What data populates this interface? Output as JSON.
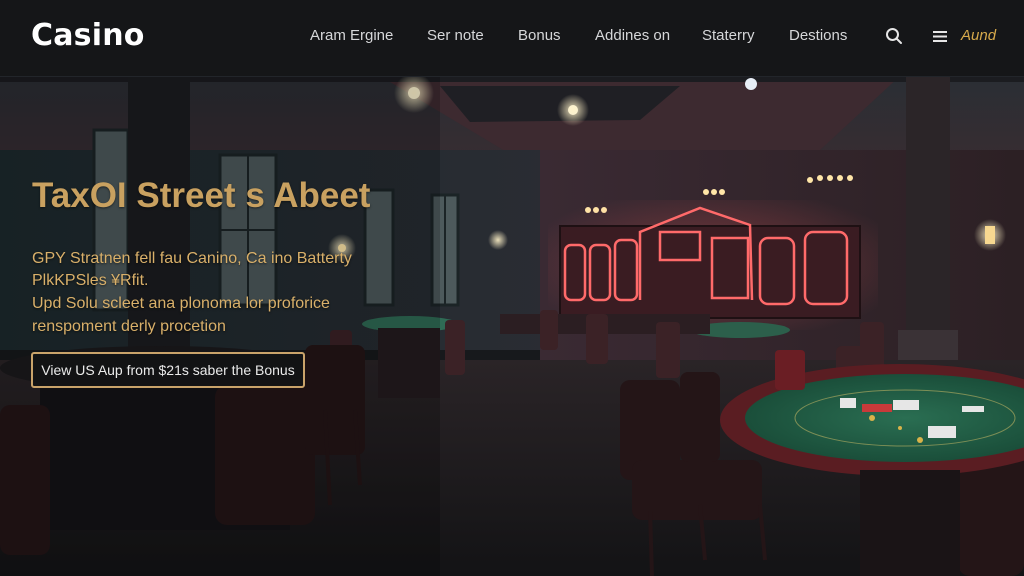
{
  "brand": {
    "logo": "Casino"
  },
  "nav": {
    "items": [
      "Aram Ergine",
      "Ser note",
      "Bonus",
      "Addines on",
      "Staterry",
      "Destions"
    ],
    "language": "Aund"
  },
  "hero": {
    "title": "TaxOI Street s Abeet",
    "lines": [
      "GPY Stratnen fell fau Canino, Ca ino Batterty",
      "PlkKPSles ¥Rfit.",
      "Upd Solu scleet ana plonoma lor proforice",
      "renspoment derly procetion"
    ],
    "cta_label": "View US Aup from $21s saber the Bonus"
  },
  "colors": {
    "accent_gold": "#c9a36a",
    "nav_bg": "#161719",
    "neon_red": "#ff5a5a",
    "felt_green": "#1f5a43"
  },
  "icons": [
    "search-icon",
    "menu-icon"
  ]
}
